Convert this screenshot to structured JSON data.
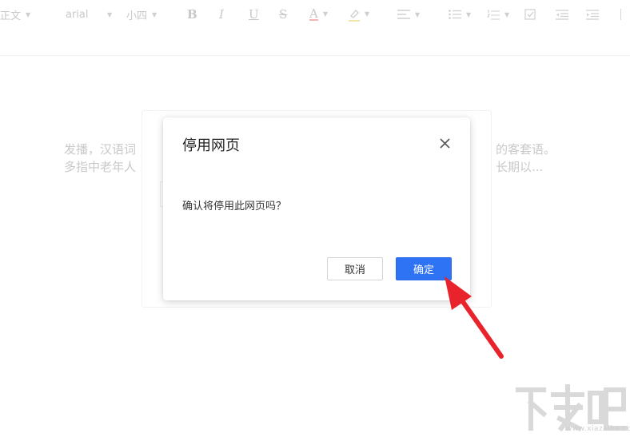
{
  "toolbar": {
    "paragraph_style": "正文",
    "font_family": "arial",
    "font_size": "小四",
    "bold_label": "B",
    "italic_label": "I",
    "underline_label": "U",
    "strike_label": "S",
    "font_color_label": "A"
  },
  "document": {
    "line1_left": "发播，汉语词",
    "line1_right": "的客套语。",
    "line2_left": "多指中老年人",
    "line2_right": "长期以..."
  },
  "dialog": {
    "title": "停用网页",
    "message": "确认将停用此网页吗？",
    "cancel_label": "取消",
    "confirm_label": "确定"
  },
  "watermark": {
    "logo_text": "下载吧",
    "site": "www.xiazaiba.com"
  },
  "colors": {
    "primary_button": "#2f73f5",
    "annotation_arrow": "#e8232b"
  }
}
